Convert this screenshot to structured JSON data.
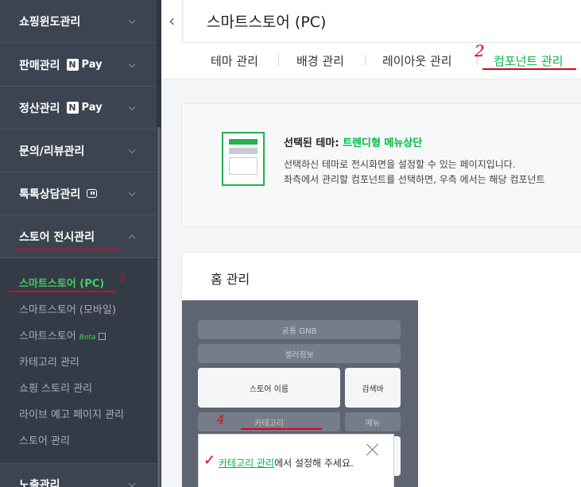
{
  "sidebar": {
    "menu": [
      {
        "label": "쇼핑윈도관리"
      },
      {
        "label": "판매관리",
        "badge": "Pay",
        "badge_n": "N"
      },
      {
        "label": "정산관리",
        "badge": "Pay",
        "badge_n": "N"
      },
      {
        "label": "문의/리뷰관리"
      },
      {
        "label": "톡톡상담관리"
      },
      {
        "label": "스토어 전시관리"
      },
      {
        "label": "노출관리"
      }
    ],
    "submenu": [
      {
        "label": "스마트스토어 (PC)"
      },
      {
        "label": "스마트스토어 (모바일)"
      },
      {
        "label": "스마트스토어",
        "beta": "Beta"
      },
      {
        "label": "카테고리 관리"
      },
      {
        "label": "쇼핑 스토리 관리"
      },
      {
        "label": "라이브 예고 페이지 관리"
      },
      {
        "label": "스토어 관리"
      }
    ]
  },
  "header": {
    "title": "스마트스토어 (PC)"
  },
  "tabs": [
    {
      "label": "테마 관리"
    },
    {
      "label": "배경 관리"
    },
    {
      "label": "레이아웃 관리"
    },
    {
      "label": "컴포넌트 관리"
    }
  ],
  "info": {
    "title_prefix": "선택된 테마:",
    "theme_name": "트렌디형 메뉴상단",
    "desc1": "선택하신 테마로 전시화면을 설정할 수 있는 페이지입니다.",
    "desc2": "좌측에서 관리할 컴포넌트를 선택하면, 우측 에서는 해당 컴포넌트"
  },
  "home": {
    "title": "홈 관리",
    "components": {
      "gnb": "공통 GNB",
      "seller": "셀러정보",
      "store_name": "스토어 이름",
      "search": "검색바",
      "category": "카테고리",
      "menu": "메뉴"
    }
  },
  "tooltip": {
    "link": "카테고리 관리",
    "rest": "에서 설정해 주세요."
  },
  "annotations": {
    "n1": "1",
    "n2": "2",
    "n4": "4",
    "check": "✓"
  },
  "colors": {
    "accent": "#00b843",
    "sidebar_bg": "#3c4451",
    "annotation": "#e0001b"
  }
}
